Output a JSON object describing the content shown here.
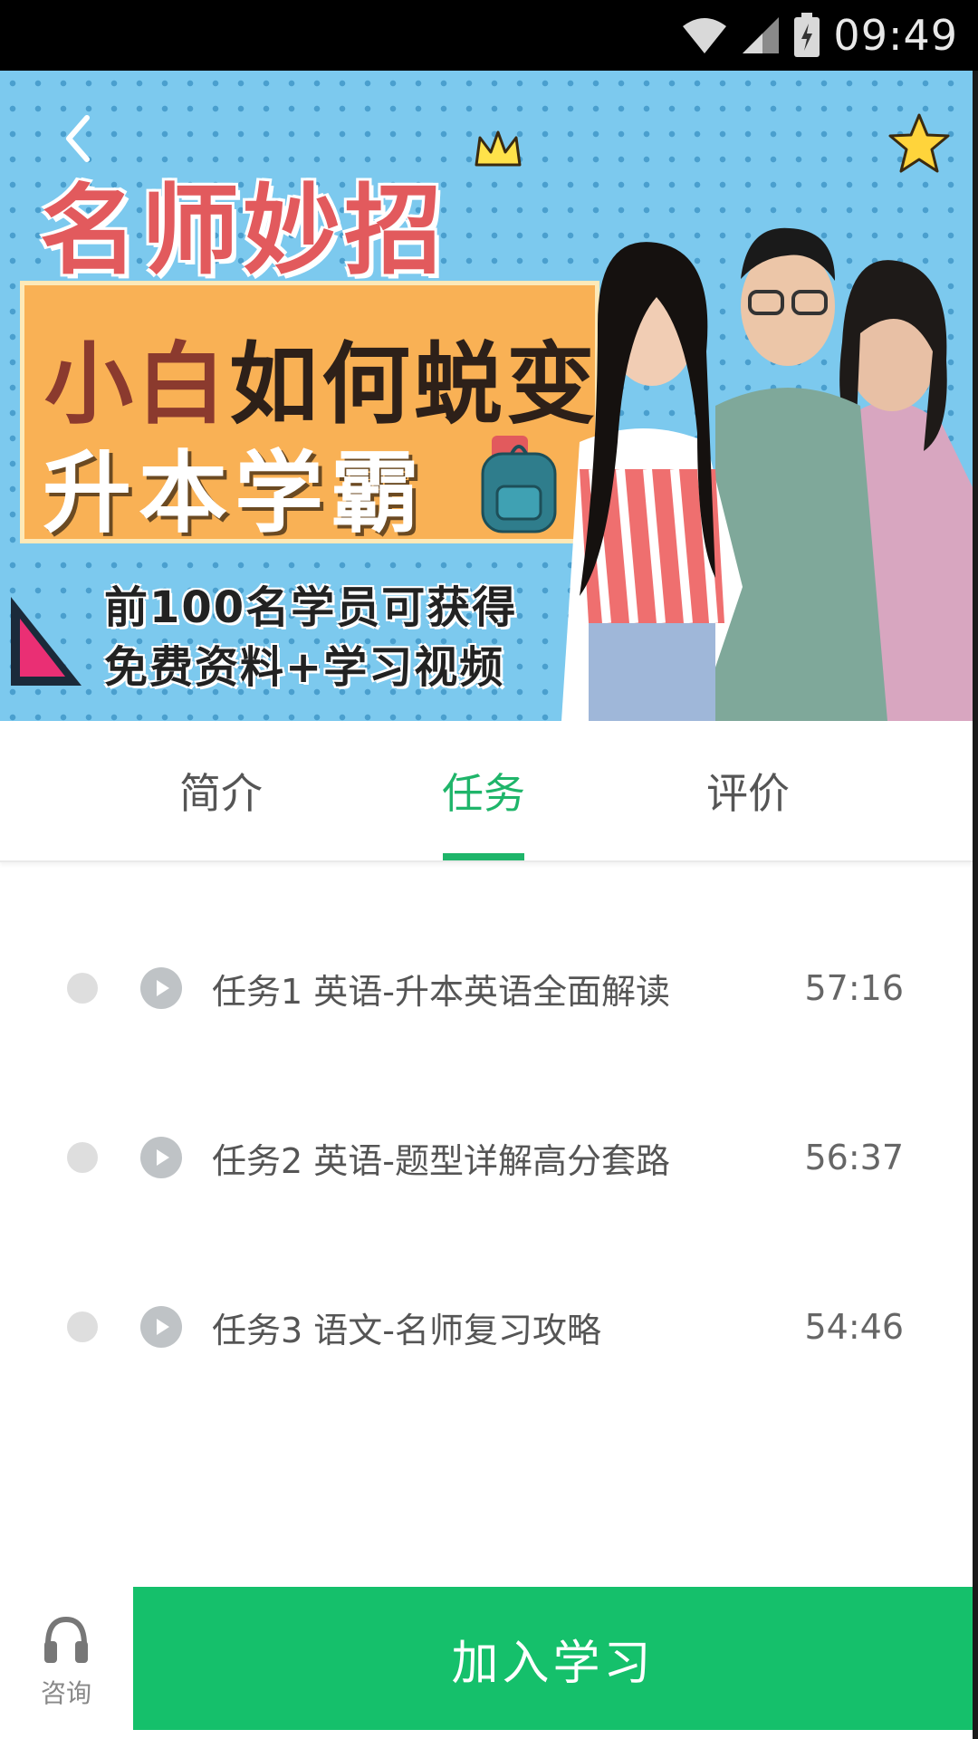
{
  "status_bar": {
    "time": "09:49",
    "icons": [
      "wifi-icon",
      "signal-icon",
      "battery-icon"
    ]
  },
  "banner": {
    "title": "名师妙招",
    "box_line1_highlight": "小白",
    "box_line1_rest": "如何蜕变",
    "box_line2": "升本学霸",
    "promo_line1": "前100名学员可获得",
    "promo_line2": "免费资料+学习视频"
  },
  "tabs": [
    {
      "label": "简介",
      "active": false
    },
    {
      "label": "任务",
      "active": true
    },
    {
      "label": "评价",
      "active": false
    }
  ],
  "tasks": [
    {
      "title": "任务1 英语-升本英语全面解读",
      "duration": "57:16"
    },
    {
      "title": "任务2 英语-题型详解高分套路",
      "duration": "56:37"
    },
    {
      "title": "任务3 语文-名师复习攻略",
      "duration": "54:46"
    }
  ],
  "bottom": {
    "consult_label": "咨询",
    "join_label": "加入学习"
  },
  "colors": {
    "accent": "#1fb56a",
    "join_button": "#15c06b",
    "banner_bg": "#7cc9ee"
  }
}
